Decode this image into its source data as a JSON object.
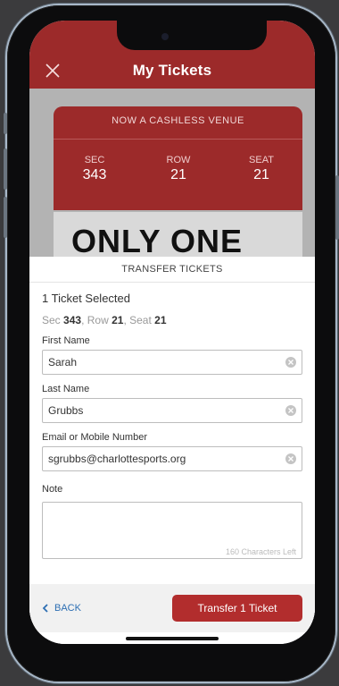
{
  "app": {
    "title": "My Tickets",
    "accent_color": "#9c2a2a",
    "button_color": "#b22d2d",
    "link_color": "#2d6fb3"
  },
  "ticket": {
    "venue_note": "NOW A CASHLESS VENUE",
    "sec_label": "SEC",
    "sec_value": "343",
    "row_label": "ROW",
    "row_value": "21",
    "seat_label": "SEAT",
    "seat_value": "21",
    "banner_text": "ONLY ONE"
  },
  "sheet": {
    "header": "TRANSFER TICKETS",
    "selected_text": "1 Ticket Selected",
    "seat_line": {
      "sec_label": "Sec",
      "sec_value": "343",
      "row_label": "Row",
      "row_value": "21",
      "seat_label": "Seat",
      "seat_value": "21"
    },
    "fields": {
      "first_name_label": "First Name",
      "first_name_value": "Sarah",
      "last_name_label": "Last Name",
      "last_name_value": "Grubbs",
      "contact_label": "Email or Mobile Number",
      "contact_value": "sgrubbs@charlottesports.org",
      "note_label": "Note",
      "note_counter": "160 Characters Left"
    },
    "back_label": "BACK",
    "transfer_label": "Transfer 1 Ticket"
  },
  "icons": {
    "close": "close-icon",
    "clear": "clear-icon",
    "back": "chevron-left-icon"
  }
}
